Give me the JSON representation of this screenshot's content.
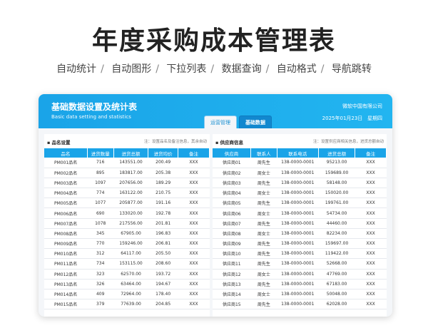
{
  "hero": {
    "title": "年度采购成本管理表",
    "features": [
      "自动统计",
      "自动图形",
      "下拉列表",
      "数据查询",
      "自动格式",
      "导航跳转"
    ],
    "separator": "/"
  },
  "banner": {
    "title": "基础数据设置及统计表",
    "subtitle_en": "Basic data setting and statistics",
    "company": "微软中国有限公司",
    "date": "2025年01月23日",
    "weekday": "星期四"
  },
  "tabs": [
    {
      "label": "运营管理"
    },
    {
      "label": "基础数据"
    }
  ],
  "left_panel": {
    "title": "品名设置",
    "note": "注：设置品名及备注信息，其余自动",
    "columns": [
      "品名",
      "进货数量",
      "进货总额",
      "进货均价",
      "备注"
    ],
    "rows": [
      [
        "PM001品名",
        "716",
        "143551.00",
        "200.49",
        "XXX"
      ],
      [
        "PM002品名",
        "895",
        "183817.00",
        "205.38",
        "XXX"
      ],
      [
        "PM003品名",
        "1097",
        "207656.00",
        "189.29",
        "XXX"
      ],
      [
        "PM004品名",
        "774",
        "163122.00",
        "210.75",
        "XXX"
      ],
      [
        "PM005品名",
        "1077",
        "205877.00",
        "191.16",
        "XXX"
      ],
      [
        "PM006品名",
        "690",
        "133020.00",
        "192.78",
        "XXX"
      ],
      [
        "PM007品名",
        "1078",
        "217556.00",
        "201.81",
        "XXX"
      ],
      [
        "PM008品名",
        "345",
        "67905.00",
        "196.83",
        "XXX"
      ],
      [
        "PM009品名",
        "770",
        "159246.00",
        "206.81",
        "XXX"
      ],
      [
        "PM010品名",
        "312",
        "64117.00",
        "205.50",
        "XXX"
      ],
      [
        "PM011品名",
        "734",
        "153115.00",
        "208.60",
        "XXX"
      ],
      [
        "PM012品名",
        "323",
        "62570.00",
        "193.72",
        "XXX"
      ],
      [
        "PM013品名",
        "326",
        "63464.00",
        "194.67",
        "XXX"
      ],
      [
        "PM014品名",
        "409",
        "72964.00",
        "178.40",
        "XXX"
      ],
      [
        "PM015品名",
        "379",
        "77639.00",
        "204.85",
        "XXX"
      ]
    ]
  },
  "right_panel": {
    "title": "供应商信息",
    "note": "注：设置供应商相关信息，进货总额自动",
    "columns": [
      "供应商",
      "联系人",
      "联系电话",
      "进货总额",
      "备注"
    ],
    "rows": [
      [
        "供应商01",
        "周先生",
        "138-0000-0001",
        "95213.00",
        "XXX"
      ],
      [
        "供应商02",
        "周女士",
        "138-0000-0001",
        "159689.00",
        "XXX"
      ],
      [
        "供应商03",
        "周先生",
        "138-0000-0001",
        "58148.00",
        "XXX"
      ],
      [
        "供应商04",
        "周女士",
        "138-0000-0001",
        "150020.00",
        "XXX"
      ],
      [
        "供应商05",
        "周先生",
        "138-0000-0001",
        "199761.00",
        "XXX"
      ],
      [
        "供应商06",
        "周女士",
        "138-0000-0001",
        "54734.00",
        "XXX"
      ],
      [
        "供应商07",
        "周先生",
        "138-0000-0001",
        "44460.00",
        "XXX"
      ],
      [
        "供应商08",
        "周女士",
        "138-0000-0001",
        "82234.00",
        "XXX"
      ],
      [
        "供应商09",
        "周先生",
        "138-0000-0001",
        "159697.00",
        "XXX"
      ],
      [
        "供应商10",
        "周先生",
        "138-0000-0001",
        "119422.00",
        "XXX"
      ],
      [
        "供应商11",
        "周先生",
        "138-0000-0001",
        "52668.00",
        "XXX"
      ],
      [
        "供应商12",
        "周女士",
        "138-0000-0001",
        "47769.00",
        "XXX"
      ],
      [
        "供应商13",
        "周先生",
        "138-0000-0001",
        "67183.00",
        "XXX"
      ],
      [
        "供应商14",
        "周女士",
        "138-0000-0001",
        "50048.00",
        "XXX"
      ],
      [
        "供应商15",
        "周先生",
        "138-0000-0001",
        "62028.00",
        "XXX"
      ]
    ]
  },
  "colors": {
    "accent": "#1aa4e8",
    "tab_active": "#1288cf"
  }
}
